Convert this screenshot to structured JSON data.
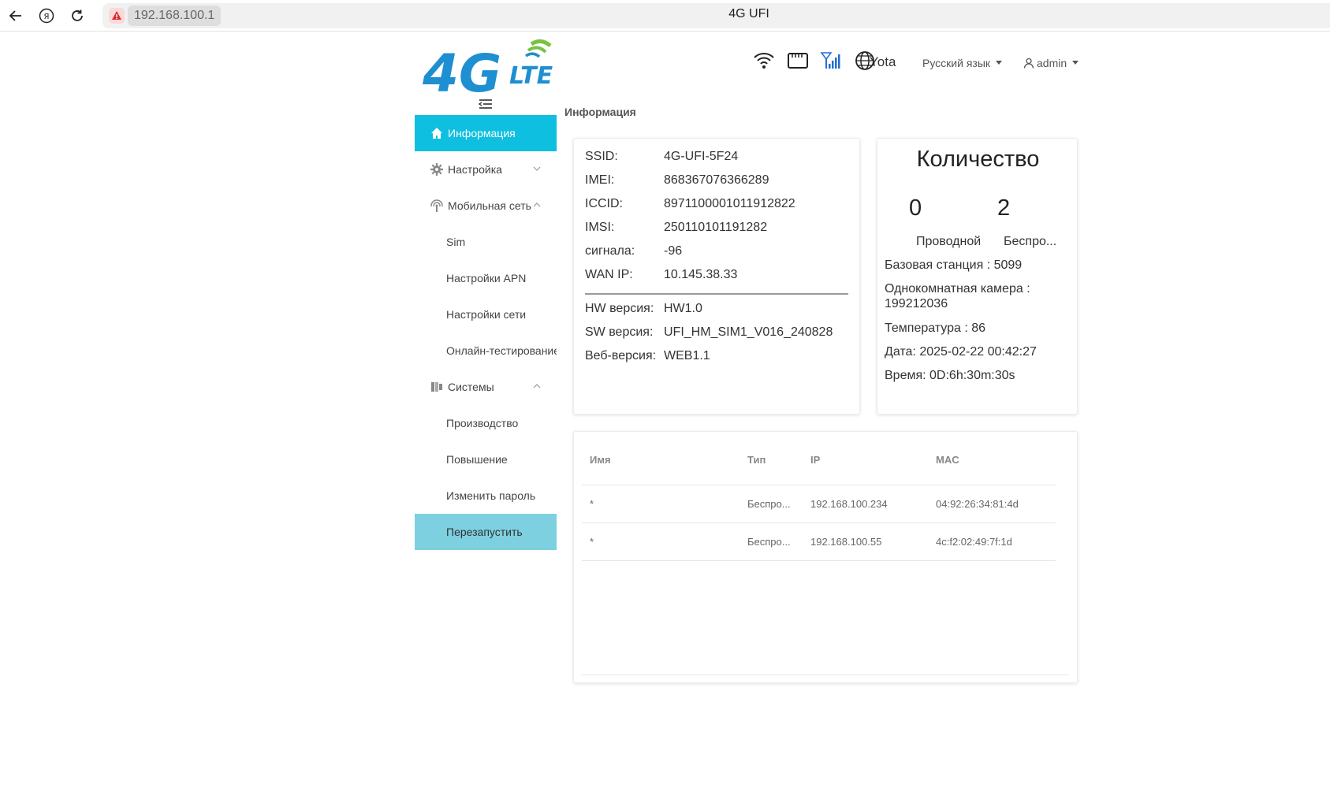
{
  "browser": {
    "url": "192.168.100.1",
    "tab_title": "4G UFI"
  },
  "header": {
    "logo_text": "4G LTE",
    "operator": "Yota",
    "language": "Русский язык",
    "user": "admin"
  },
  "sidebar": {
    "items": [
      {
        "label": "Информация"
      },
      {
        "label": "Настройка"
      },
      {
        "label": "Мобильная сеть"
      },
      {
        "label": "Sim"
      },
      {
        "label": "Настройки APN"
      },
      {
        "label": "Настройки сети"
      },
      {
        "label": "Онлайн-тестирование"
      },
      {
        "label": "Системы"
      },
      {
        "label": "Производство"
      },
      {
        "label": "Повышение"
      },
      {
        "label": "Изменить пароль"
      },
      {
        "label": "Перезапустить"
      }
    ]
  },
  "main": {
    "title": "Информация",
    "info": {
      "rows": [
        {
          "key": "SSID:",
          "value": "4G-UFI-5F24"
        },
        {
          "key": "IMEI:",
          "value": "868367076366289"
        },
        {
          "key": "ICCID:",
          "value": "8971100001011912822"
        },
        {
          "key": "IMSI:",
          "value": "250110101191282"
        },
        {
          "key": "сигнала:",
          "value": "-96"
        },
        {
          "key": "WAN IP:",
          "value": "10.145.38.33"
        }
      ],
      "versions": [
        {
          "key": "HW версия:",
          "value": "HW1.0"
        },
        {
          "key": "SW версия:",
          "value": "UFI_HM_SIM1_V016_240828"
        },
        {
          "key": "Веб-версия:",
          "value": "WEB1.1"
        }
      ]
    },
    "count": {
      "title": "Количество",
      "wired_count": "0",
      "wireless_count": "2",
      "wired_label": "Проводной",
      "wireless_label": "Беспро...",
      "base_station": "Базовая станция : 5099",
      "cell": "Однокомнатная камера : 199212036",
      "temperature": "Температура : 86",
      "date": "Дата: 2025-02-22 00:42:27",
      "time": "Время: 0D:6h:30m:30s"
    },
    "clients": {
      "headers": [
        "Имя",
        "Тип",
        "IP",
        "MAC"
      ],
      "rows": [
        [
          "*",
          "Беспро...",
          "192.168.100.234",
          "04:92:26:34:81:4d"
        ],
        [
          "*",
          "Беспро...",
          "192.168.100.55",
          "4c:f2:02:49:7f:1d"
        ]
      ]
    }
  },
  "colors": {
    "accent": "#0fbfe0",
    "restart_bg": "#7dd0e0",
    "logo_blue": "#1e8fd0",
    "logo_green": "#7bc142"
  }
}
